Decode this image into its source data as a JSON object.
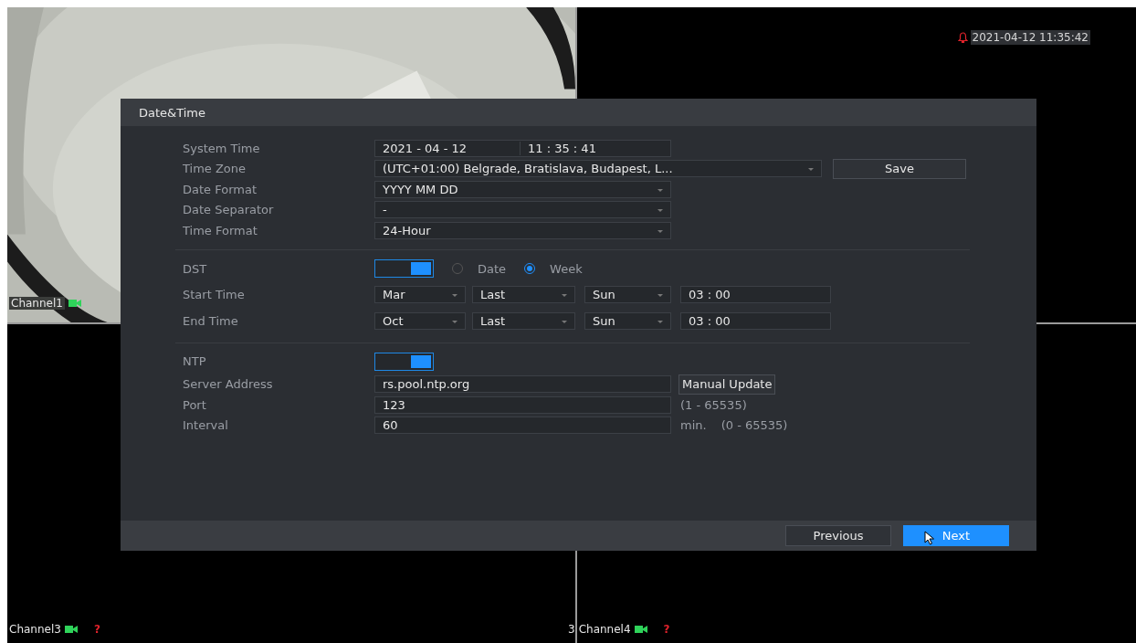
{
  "clock": {
    "time": "2021-04-12 11:35:42"
  },
  "channels": [
    {
      "kind": "picture",
      "label": "Channel1"
    },
    {
      "kind": "empty"
    },
    {
      "kind": "black",
      "label": "Channel3",
      "status": "?"
    },
    {
      "kind": "black",
      "prefix": "3",
      "label": "Channel4",
      "status": "?"
    }
  ],
  "dialog": {
    "title": "Date&Time",
    "system_time": {
      "label": "System Time",
      "date": "2021  - 04 - 12",
      "time": "11 : 35 : 41"
    },
    "time_zone": {
      "label": "Time Zone",
      "value": "(UTC+01:00) Belgrade, Bratislava, Budapest, L...",
      "button": "Save"
    },
    "selects": [
      {
        "label": "Date Format",
        "value": "YYYY MM DD"
      },
      {
        "label": "Date Separator",
        "value": "-"
      },
      {
        "label": "Time Format",
        "value": "24-Hour"
      }
    ],
    "dst": {
      "label": "DST",
      "on": true,
      "modes": [
        {
          "label": "Date",
          "selected": false
        },
        {
          "label": "Week",
          "selected": true
        }
      ],
      "rows": [
        {
          "label": "Start Time",
          "month": "Mar",
          "week": "Last",
          "day": "Sun",
          "time": "03 : 00"
        },
        {
          "label": "End Time",
          "month": "Oct",
          "week": "Last",
          "day": "Sun",
          "time": "03 : 00"
        }
      ]
    },
    "ntp": {
      "label": "NTP",
      "on": true,
      "server": {
        "label": "Server Address",
        "value": "rs.pool.ntp.org",
        "button": "Manual Update"
      },
      "port": {
        "label": "Port",
        "value": "123",
        "hint": "(1 - 65535)"
      },
      "interval": {
        "label": "Interval",
        "value": "60",
        "unit": "min.",
        "hint": "(0 - 65535)"
      }
    },
    "buttons": [
      {
        "label": "Previous",
        "primary": false
      },
      {
        "label": "Next",
        "primary": true
      }
    ]
  }
}
